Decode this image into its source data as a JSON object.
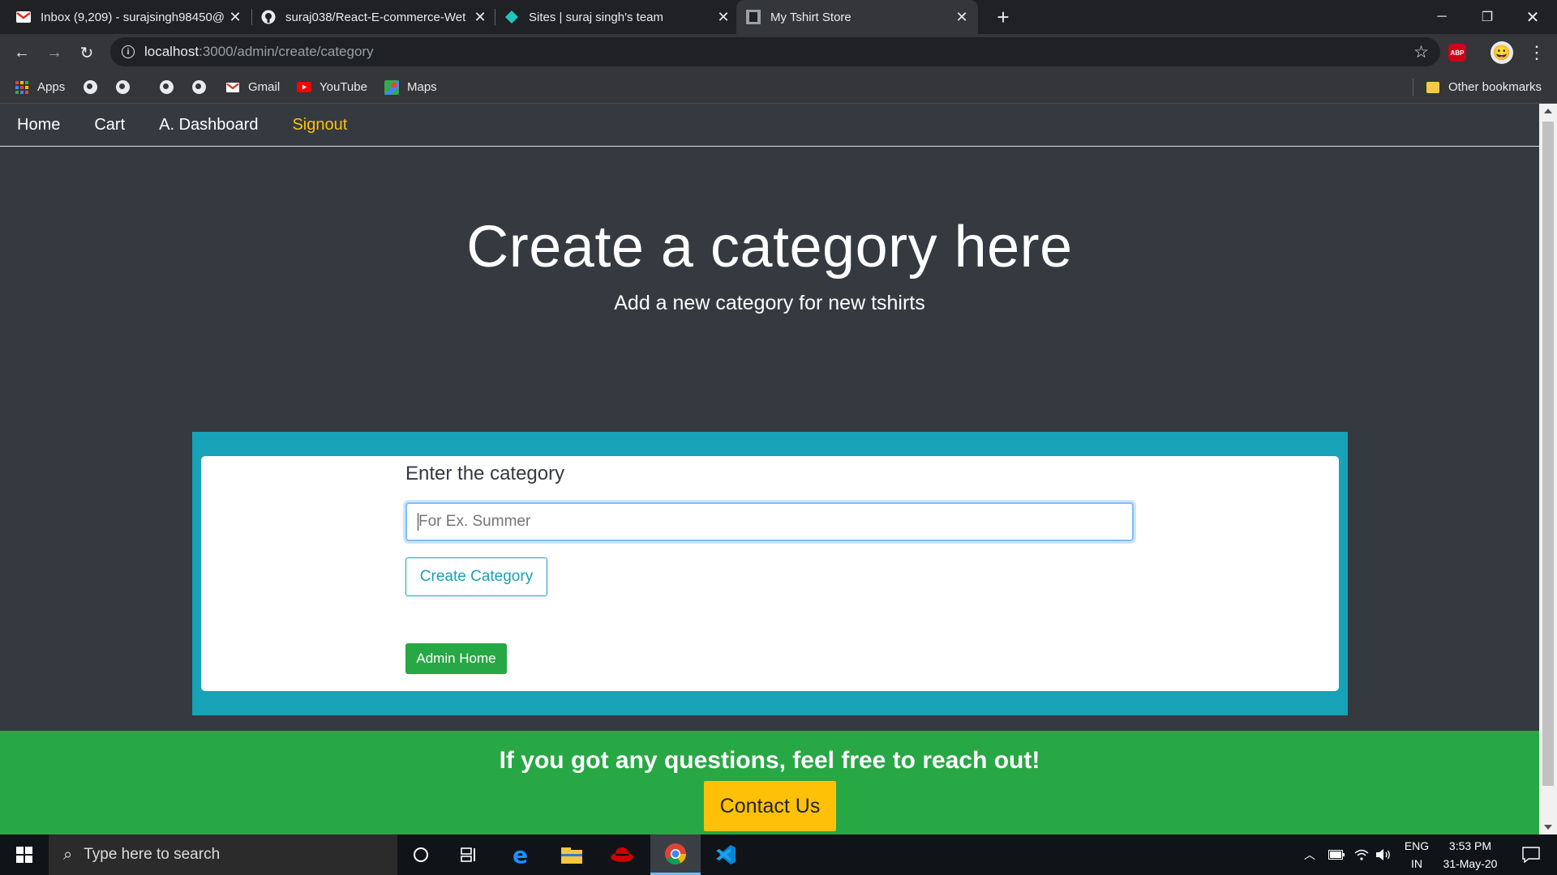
{
  "browser": {
    "tabs": [
      {
        "title": "Inbox (9,209) - surajsingh98450@",
        "icon": "gmail-icon"
      },
      {
        "title": "suraj038/React-E-commerce-Wet",
        "icon": "github-icon"
      },
      {
        "title": "Sites | suraj singh's team",
        "icon": "netlify-icon"
      },
      {
        "title": "My Tshirt Store",
        "icon": "site-icon"
      }
    ],
    "active_tab": 3,
    "url_host": "localhost",
    "url_path": ":3000/admin/create/category",
    "bookmarks": {
      "apps": "Apps",
      "gmail": "Gmail",
      "youtube": "YouTube",
      "maps": "Maps",
      "other": "Other bookmarks"
    },
    "abp_label": "ABP"
  },
  "site": {
    "nav": [
      {
        "label": "Home"
      },
      {
        "label": "Cart"
      },
      {
        "label": "A. Dashboard"
      },
      {
        "label": "Signout"
      }
    ],
    "title": "Create a category here",
    "description": "Add a new category for new tshirts",
    "form": {
      "label": "Enter the category",
      "placeholder": "For Ex. Summer",
      "value": "",
      "submit_label": "Create Category",
      "admin_home_label": "Admin Home"
    },
    "footer": {
      "text": "If you got any questions, feel free to reach out!",
      "contact_label": "Contact Us"
    },
    "colors": {
      "background": "#343a40",
      "info": "#17a2b8",
      "success": "#28a745",
      "warning": "#ffc107"
    }
  },
  "taskbar": {
    "search_placeholder": "Type here to search",
    "language_line1": "ENG",
    "language_line2": "IN",
    "time": "3:53 PM",
    "date": "31-May-20"
  }
}
